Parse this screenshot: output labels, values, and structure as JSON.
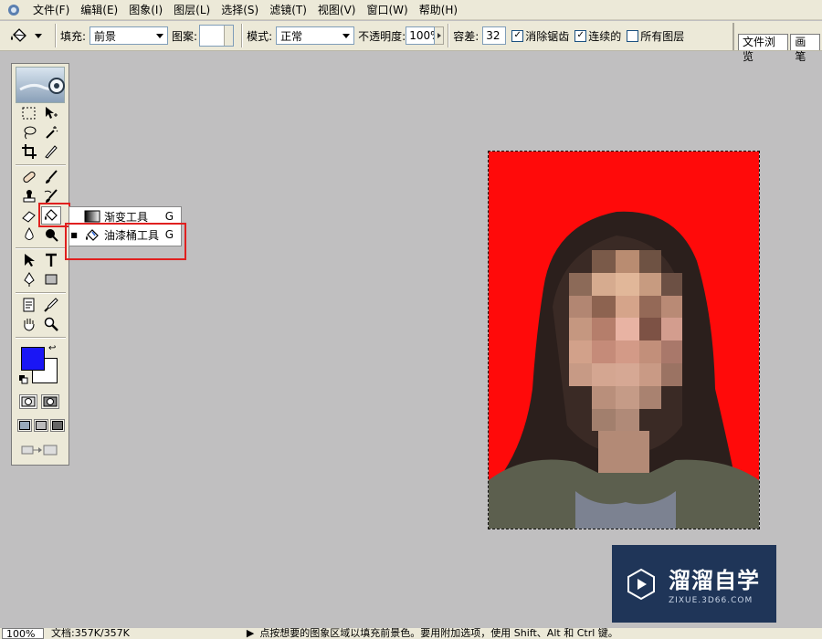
{
  "menubar": {
    "items": [
      "文件(F)",
      "编辑(E)",
      "图象(I)",
      "图层(L)",
      "选择(S)",
      "滤镜(T)",
      "视图(V)",
      "窗口(W)",
      "帮助(H)"
    ]
  },
  "options": {
    "fill_label": "填充:",
    "fill_value": "前景",
    "pattern_label": "图案:",
    "mode_label": "模式:",
    "mode_value": "正常",
    "opacity_label": "不透明度:",
    "opacity_value": "100%",
    "tolerance_label": "容差:",
    "tolerance_value": "32",
    "antialias_label": "消除锯齿",
    "antialias_checked": true,
    "contiguous_label": "连续的",
    "contiguous_checked": true,
    "all_layers_label": "所有图层",
    "all_layers_checked": false,
    "palette_tabs": [
      "文件浏览",
      "画笔"
    ]
  },
  "flyout": {
    "items": [
      {
        "label": "渐变工具",
        "shortcut": "G",
        "active": false
      },
      {
        "label": "油漆桶工具",
        "shortcut": "G",
        "active": true
      }
    ]
  },
  "colors": {
    "foreground": "#1a16f5",
    "background": "#ffffff",
    "canvas_fill": "#ff0a0a",
    "highlight": "#e0201f"
  },
  "watermark": {
    "title": "溜溜自学",
    "subtitle": "ZIXUE.3D66.COM"
  },
  "statusbar": {
    "zoom": "100%",
    "doc_info": "文档:357K/357K",
    "message": "点按想要的图象区域以填充前景色。要用附加选项，使用 Shift、Alt 和 Ctrl 键。"
  }
}
